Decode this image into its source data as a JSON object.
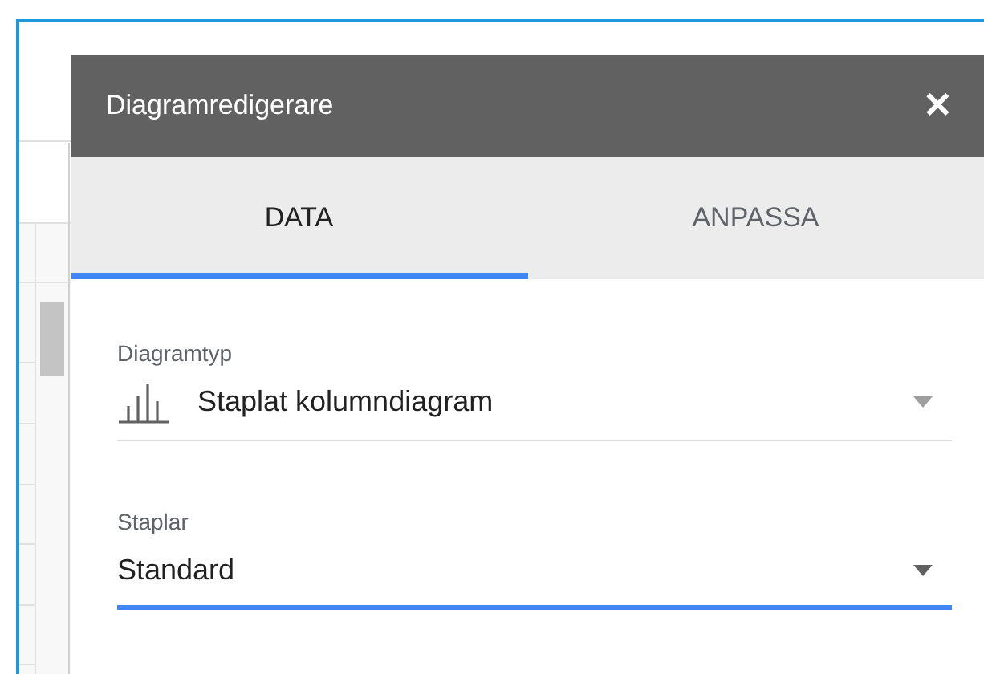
{
  "panel": {
    "title": "Diagramredigerare",
    "close": "✕"
  },
  "tabs": [
    {
      "label": "DATA",
      "selected": true
    },
    {
      "label": "ANPASSA",
      "selected": false
    }
  ],
  "fields": [
    {
      "kind": "chart",
      "label": "Diagramtyp",
      "value": "Staplat kolumndiagram",
      "focused": false
    },
    {
      "kind": "plain",
      "label": "Staplar",
      "value": "Standard",
      "focused": true
    }
  ]
}
